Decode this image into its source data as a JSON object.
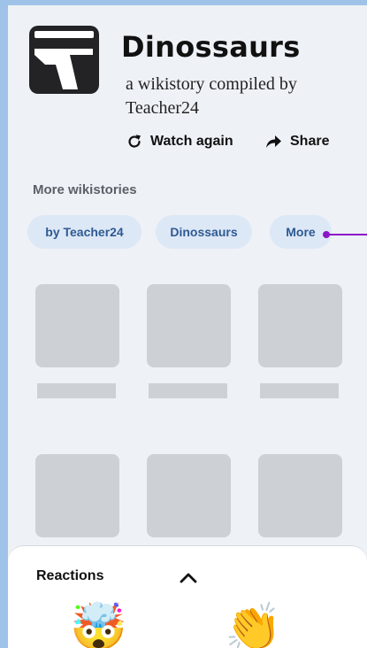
{
  "title": "Dinossaurs",
  "subtitle": "a wikistory compiled by Teacher24",
  "actions": {
    "watch_again": "Watch again",
    "share": "Share"
  },
  "more_section": {
    "label": "More wikistories",
    "chips": [
      "by Teacher24",
      "Dinossaurs",
      "More"
    ]
  },
  "reactions": {
    "title": "Reactions",
    "items": [
      {
        "icon": "exploding-head-emoji",
        "glyph": "🤯"
      },
      {
        "icon": "clapping-hands-emoji",
        "glyph": "👏"
      }
    ]
  },
  "colors": {
    "chip_bg": "#dde8f6",
    "chip_text": "#2e5a93",
    "accent_pointer": "#8b15c8",
    "placeholder": "#cdd0d5",
    "background": "#eef1f6"
  }
}
